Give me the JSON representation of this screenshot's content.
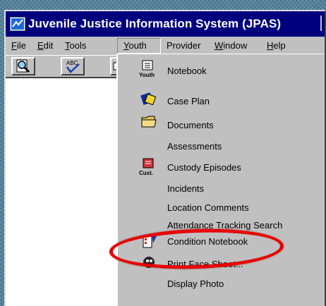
{
  "window": {
    "title": "Juvenile Justice Information System (JPAS)"
  },
  "menubar": {
    "items": [
      {
        "label": "File"
      },
      {
        "label": "Edit"
      },
      {
        "label": "Tools"
      },
      {
        "label": "Youth"
      },
      {
        "label": "Provider"
      },
      {
        "label": "Window"
      },
      {
        "label": "Help"
      }
    ],
    "active": "Youth"
  },
  "toolbar": {
    "buttons": [
      {
        "icon": "magnifier-icon"
      },
      {
        "icon": "spellcheck-icon",
        "label": "ABC"
      },
      {
        "icon": "print-icon"
      }
    ]
  },
  "youth_menu": {
    "items": [
      {
        "label": "Notebook",
        "icon": "notebook-icon",
        "icon_caption": "Youth"
      },
      {
        "label": "Case Plan",
        "icon": "case-plan-icon"
      },
      {
        "label": "Documents",
        "icon": "folder-icon"
      },
      {
        "label": "Assessments"
      },
      {
        "label": "Custody Episodes",
        "icon": "custody-icon",
        "icon_caption": "Cust."
      },
      {
        "label": "Incidents"
      },
      {
        "label": "Location Comments"
      },
      {
        "label": "Attendance Tracking Search"
      },
      {
        "label": "Condition Notebook",
        "icon": "condition-notebook-icon",
        "highlighted": true
      },
      {
        "label": "Print Face Sheet...",
        "icon": "face-sheet-icon"
      },
      {
        "label": "Display Photo"
      }
    ]
  },
  "colors": {
    "titlebar": "#00007f",
    "highlight_ring": "#e60000",
    "chrome": "#c0c0c0"
  }
}
